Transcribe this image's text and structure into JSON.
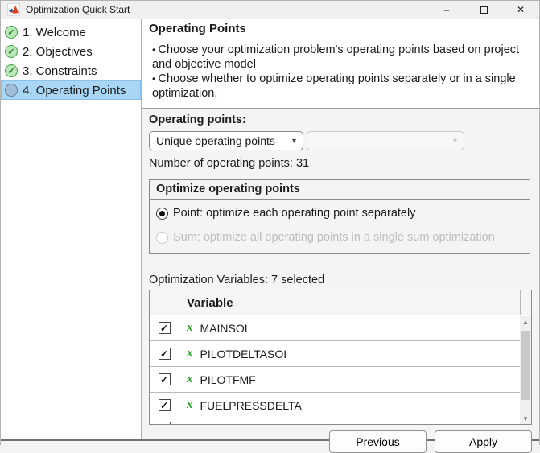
{
  "window": {
    "title": "Optimization Quick Start",
    "controls": {
      "minimize": "–",
      "close": "✕"
    }
  },
  "icons": {
    "dropdown_arrow": "▾",
    "check": "✓",
    "scroll_up": "▲",
    "scroll_down": "▼"
  },
  "sidebar": {
    "items": [
      {
        "label": "1. Welcome",
        "status": "complete"
      },
      {
        "label": "2. Objectives",
        "status": "complete"
      },
      {
        "label": "3. Constraints",
        "status": "complete"
      },
      {
        "label": "4. Operating Points",
        "status": "current"
      }
    ]
  },
  "main": {
    "heading": "Operating Points",
    "bullets": [
      "Choose your optimization problem's operating points based on project and objective model",
      "Choose whether to optimize operating points separately or in a single optimization."
    ],
    "operating_points": {
      "label": "Operating points:",
      "dropdown_value": "Unique operating points",
      "dropdown2_value": "",
      "count_label": "Number of operating points: 31"
    },
    "optimize_group": {
      "title": "Optimize operating points",
      "radio_point": "Point: optimize each operating point separately",
      "radio_sum": "Sum: optimize all operating points in a single sum optimization"
    },
    "variables": {
      "label": "Optimization Variables: 7 selected",
      "column_header": "Variable",
      "rows": [
        {
          "name": "MAINSOI",
          "checked": true
        },
        {
          "name": "PILOTDELTASOI",
          "checked": true
        },
        {
          "name": "PILOTFMF",
          "checked": true
        },
        {
          "name": "FUELPRESSDELTA",
          "checked": true
        }
      ]
    }
  },
  "footer": {
    "previous_label": "Previous",
    "apply_label": "Apply"
  },
  "colors": {
    "accent_selection": "#a8d6f4",
    "step_complete_green": "#44a044",
    "variable_x_green": "#27a327",
    "panel_gray": "#f4f4f4"
  }
}
